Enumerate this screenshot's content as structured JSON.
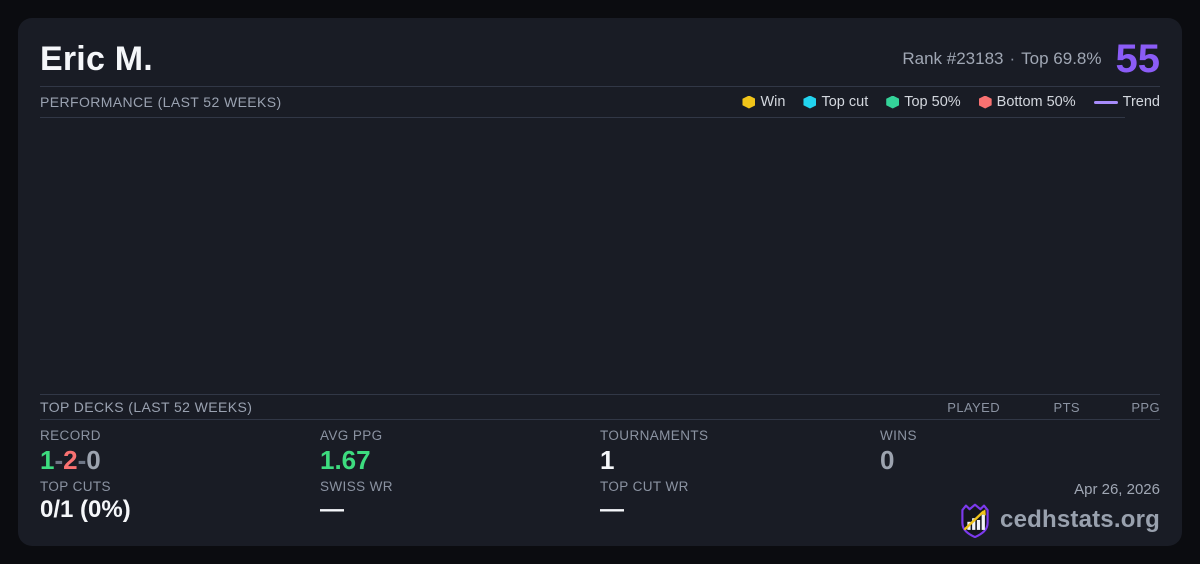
{
  "header": {
    "player_name": "Eric M.",
    "rank_text": "Rank #23183",
    "separator": "·",
    "top_percent": "Top 69.8%",
    "score": "55"
  },
  "performance": {
    "title": "PERFORMANCE (LAST 52 WEEKS)",
    "legend": [
      {
        "label": "Win",
        "color": "#f0c419",
        "marker": "hexagon"
      },
      {
        "label": "Top cut",
        "color": "#22d3ee",
        "marker": "hexagon"
      },
      {
        "label": "Top 50%",
        "color": "#34d399",
        "marker": "hexagon"
      },
      {
        "label": "Bottom 50%",
        "color": "#f87171",
        "marker": "hexagon"
      },
      {
        "label": "Trend",
        "color": "#a78bfa",
        "marker": "line"
      }
    ],
    "data_points": []
  },
  "top_decks": {
    "title": "TOP DECKS (LAST 52 WEEKS)",
    "columns": [
      "PLAYED",
      "PTS",
      "PPG"
    ],
    "rows": []
  },
  "stats": {
    "record": {
      "label": "RECORD",
      "wins": "1",
      "losses": "2",
      "draws": "0",
      "separator": "-"
    },
    "avg_ppg": {
      "label": "AVG PPG",
      "value": "1.67"
    },
    "tournaments": {
      "label": "TOURNAMENTS",
      "value": "1"
    },
    "wins": {
      "label": "WINS",
      "value": "0"
    },
    "top_cuts": {
      "label": "TOP CUTS",
      "value": "0/1 (0%)"
    },
    "swiss_wr": {
      "label": "SWISS WR",
      "value": "—"
    },
    "top_cut_wr": {
      "label": "TOP CUT WR",
      "value": "—"
    }
  },
  "footer": {
    "date": "Apr 26, 2026",
    "site": "cedhstats.org"
  },
  "colors": {
    "page_bg": "#0b0c10",
    "card_bg": "#191c25",
    "accent_purple": "#8b5cf6",
    "trend_purple": "#a78bfa",
    "win_yellow": "#f0c419",
    "topcut_cyan": "#22d3ee",
    "top50_green": "#34d399",
    "bottom50_red": "#f87171",
    "record_green": "#3ddc7f",
    "divider": "#313746"
  }
}
